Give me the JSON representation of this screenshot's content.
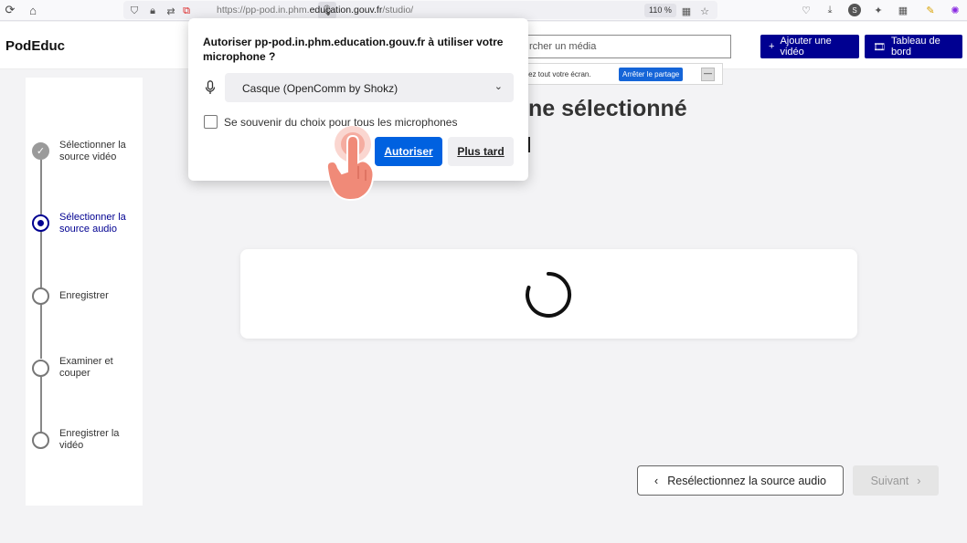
{
  "browser": {
    "url_prefix": "https://pp-pod.in.phm.",
    "url_domain": "education.gouv.fr",
    "url_path": "/studio/",
    "zoom": "110 %"
  },
  "header": {
    "logo": "PodEduc",
    "search_placeholder": "rcher un média",
    "add_video": "Ajouter une vidéo",
    "dashboard": "Tableau de bord"
  },
  "sharebar": {
    "text": "tagez tout votre écran.",
    "stop": "Arrêter le partage",
    "minimize": "—"
  },
  "steps": [
    {
      "label": "Sélectionner la source vidéo",
      "state": "done"
    },
    {
      "label": "Sélectionner la source audio",
      "state": "active"
    },
    {
      "label": "Enregistrer",
      "state": "todo"
    },
    {
      "label": "Examiner et couper",
      "state": "todo"
    },
    {
      "label": "Enregistrer la vidéo",
      "state": "todo"
    }
  ],
  "main": {
    "title": "ne sélectionné"
  },
  "footer": {
    "back": "Resélectionnez la source audio",
    "next": "Suivant"
  },
  "popup": {
    "title": "Autoriser pp-pod.in.phm.education.gouv.fr à utiliser votre microphone ?",
    "device": "Casque (OpenComm by Shokz)",
    "remember": "Se souvenir du choix pour tous les microphones",
    "allow": "Autoriser",
    "later": "Plus tard"
  },
  "colors": {
    "primary": "#000091",
    "firefox_blue": "#0061e0",
    "hand": "#f08a78"
  }
}
